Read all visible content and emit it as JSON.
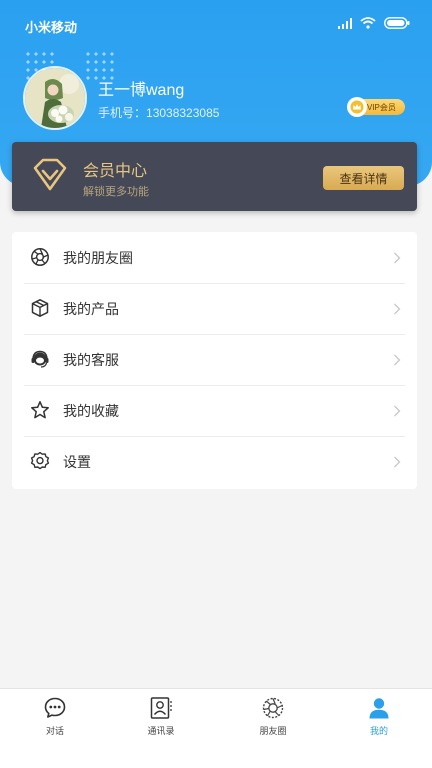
{
  "status_bar": {
    "carrier": "小米移动"
  },
  "profile": {
    "name": "王一博wang",
    "phone_label": "手机号：",
    "phone": "13038323085",
    "vip_badge": "VIP会员"
  },
  "member_card": {
    "title": "会员中心",
    "subtitle": "解锁更多功能",
    "button": "查看详情"
  },
  "menu": {
    "items": [
      {
        "label": "我的朋友圈",
        "icon": "aperture-icon"
      },
      {
        "label": "我的产品",
        "icon": "box-icon"
      },
      {
        "label": "我的客服",
        "icon": "headset-icon"
      },
      {
        "label": "我的收藏",
        "icon": "star-icon"
      },
      {
        "label": "设置",
        "icon": "gear-icon"
      }
    ]
  },
  "bottom_nav": {
    "items": [
      {
        "label": "对话",
        "icon": "chat-icon"
      },
      {
        "label": "通讯录",
        "icon": "contacts-icon"
      },
      {
        "label": "朋友圈",
        "icon": "moments-icon"
      },
      {
        "label": "我的",
        "icon": "person-icon",
        "active": true
      }
    ]
  },
  "colors": {
    "header_blue": "#2aa0f0",
    "member_card_bg": "#444857",
    "gold": "#e9c680",
    "active_tab": "#2a9fea"
  }
}
